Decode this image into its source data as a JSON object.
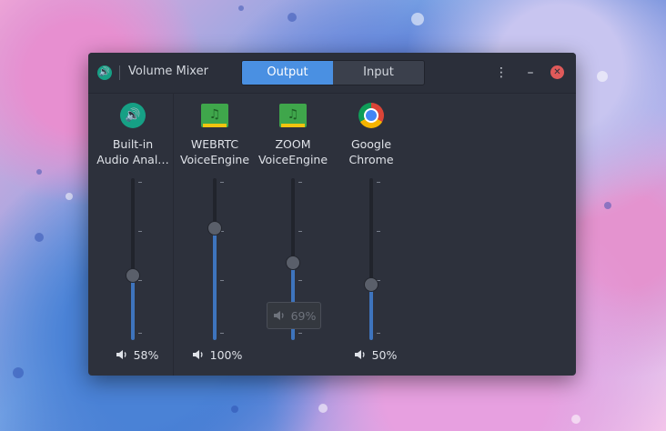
{
  "window": {
    "title": "Volume Mixer",
    "tabs": [
      {
        "label": "Output",
        "active": true
      },
      {
        "label": "Input",
        "active": false
      }
    ],
    "menu_icon": "⋮",
    "minimize_icon": "–",
    "close_icon": "✕"
  },
  "devices": [
    {
      "name_line1": "Built-in",
      "name_line2": "Audio Anal…",
      "icon": "speaker-icon",
      "volume_percent": 58,
      "volume_label": "58%",
      "muted": false,
      "slider_level": 0.4
    },
    {
      "name_line1": "WEBRTC",
      "name_line2": "VoiceEngine",
      "icon": "music-folder-icon",
      "volume_percent": 100,
      "volume_label": "100%",
      "muted": false,
      "slider_level": 0.69
    },
    {
      "name_line1": "ZOOM",
      "name_line2": "VoiceEngine",
      "icon": "music-folder-icon",
      "volume_percent": 69,
      "volume_label": "69%",
      "muted": true,
      "slider_level": 0.48
    },
    {
      "name_line1": "Google",
      "name_line2": "Chrome",
      "icon": "chrome-icon",
      "volume_percent": 50,
      "volume_label": "50%",
      "muted": false,
      "slider_level": 0.34
    }
  ],
  "colors": {
    "accent": "#4a90e2",
    "fill": "#3e74bd",
    "close": "#e05a5a",
    "app_green": "#16a085"
  }
}
